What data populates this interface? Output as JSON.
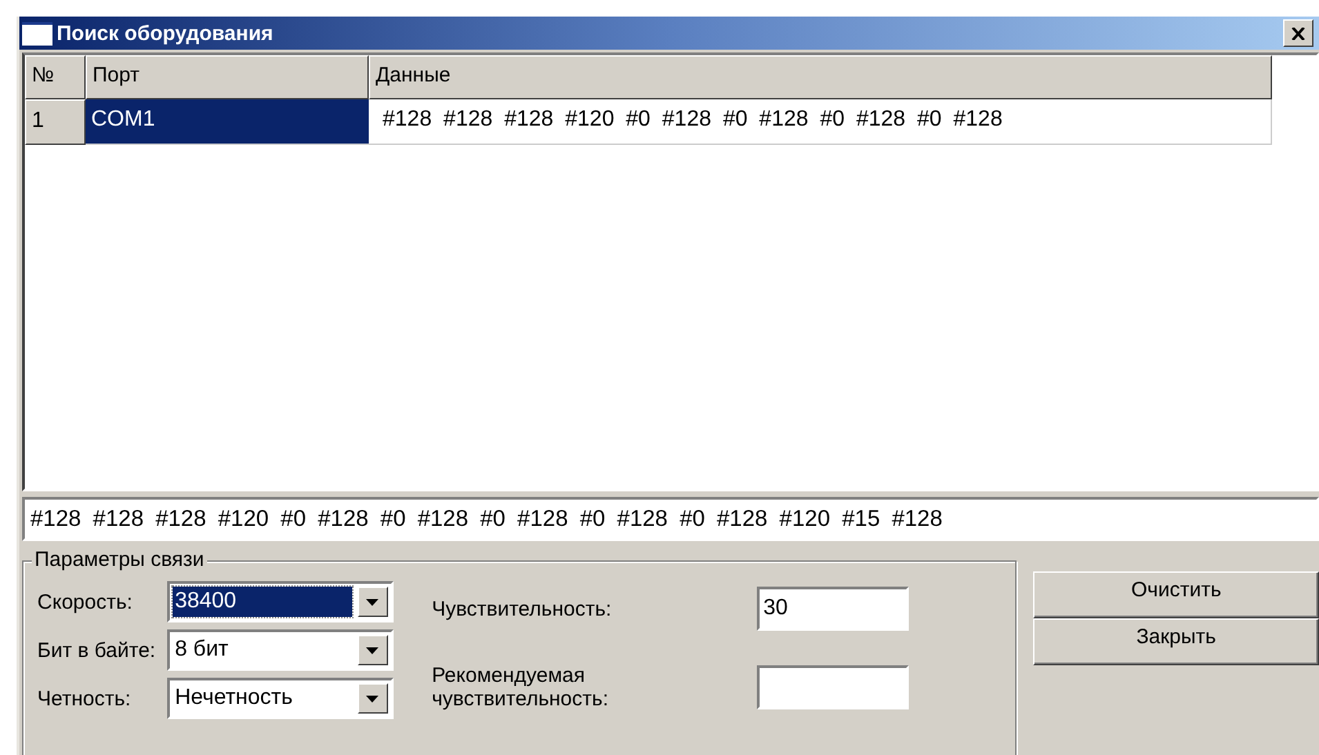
{
  "window": {
    "title": "Поиск оборудования"
  },
  "table": {
    "columns": [
      "№",
      "Порт",
      "Данные"
    ],
    "rows": [
      {
        "cells": [
          "1",
          "COM1",
          "#128 #128 #128 #120 #0 #128 #0 #128 #0 #128 #0 #128"
        ],
        "selected": true
      }
    ]
  },
  "data_line": "#128 #128 #128 #120 #0 #128 #0 #128 #0 #128 #0 #128 #0 #128 #120 #15 #128",
  "connection_params": {
    "title": "Параметры связи",
    "fields": [
      {
        "label": "Скорость:",
        "value": "38400",
        "focused": true
      },
      {
        "label": "Бит в байте:",
        "value": "8 бит",
        "focused": false
      },
      {
        "label": "Четность:",
        "value": "Нечетность",
        "focused": false
      }
    ]
  },
  "sensitivity": {
    "label": "Чувствительность:",
    "value": "30"
  },
  "recommended_sensitivity": {
    "label": "Рекомендуемая чувствительность:"
  },
  "buttons": [
    "Очистить",
    "Закрыть"
  ]
}
